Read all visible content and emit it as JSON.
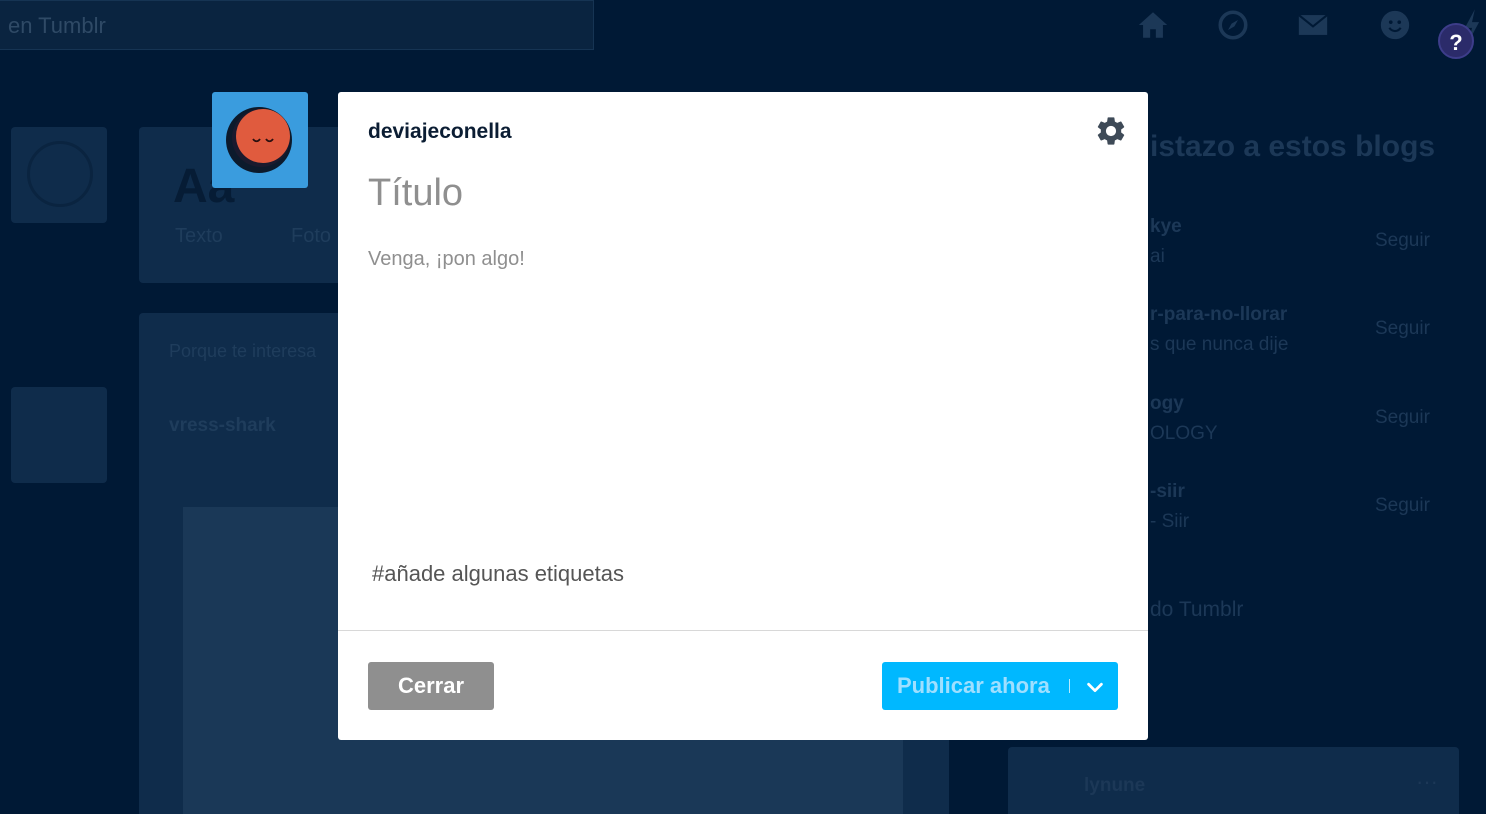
{
  "background": {
    "search": {
      "text": "en Tumblr"
    },
    "nav_icons": [
      "home-icon",
      "compass-icon",
      "mail-icon",
      "smiley-icon",
      "lightning-icon"
    ],
    "help_label": "?",
    "post_types": [
      {
        "icon": "Aa",
        "label": "Texto"
      },
      {
        "label": "Foto"
      }
    ],
    "feed": {
      "reason": "Porque te interesa",
      "blog_name": "vress-shark"
    },
    "recommended": {
      "title": "istazo a estos blogs",
      "items": [
        {
          "name": "kye",
          "subtitle": "ai",
          "follow": "Seguir"
        },
        {
          "name": "r-para-no-llorar",
          "subtitle": "s que nunca dije",
          "follow": "Seguir"
        },
        {
          "name": "ogy",
          "subtitle": "OLOGY",
          "follow": "Seguir"
        },
        {
          "name": "-siir",
          "subtitle": "- Siir",
          "follow": "Seguir"
        }
      ],
      "more": "do Tumblr"
    },
    "mini_card": {
      "name": "lynune"
    }
  },
  "composer": {
    "blog_name": "deviajeconella",
    "title_placeholder": "Título",
    "body_placeholder": "Venga, ¡pon algo!",
    "tags_placeholder": "#añade algunas etiquetas",
    "close_label": "Cerrar",
    "publish_label": "Publicar ahora",
    "colors": {
      "publish": "#00b8ff",
      "close": "#8f8f8f",
      "avatar_bg": "#3a9cde",
      "avatar_face": "#e05b3e"
    }
  }
}
